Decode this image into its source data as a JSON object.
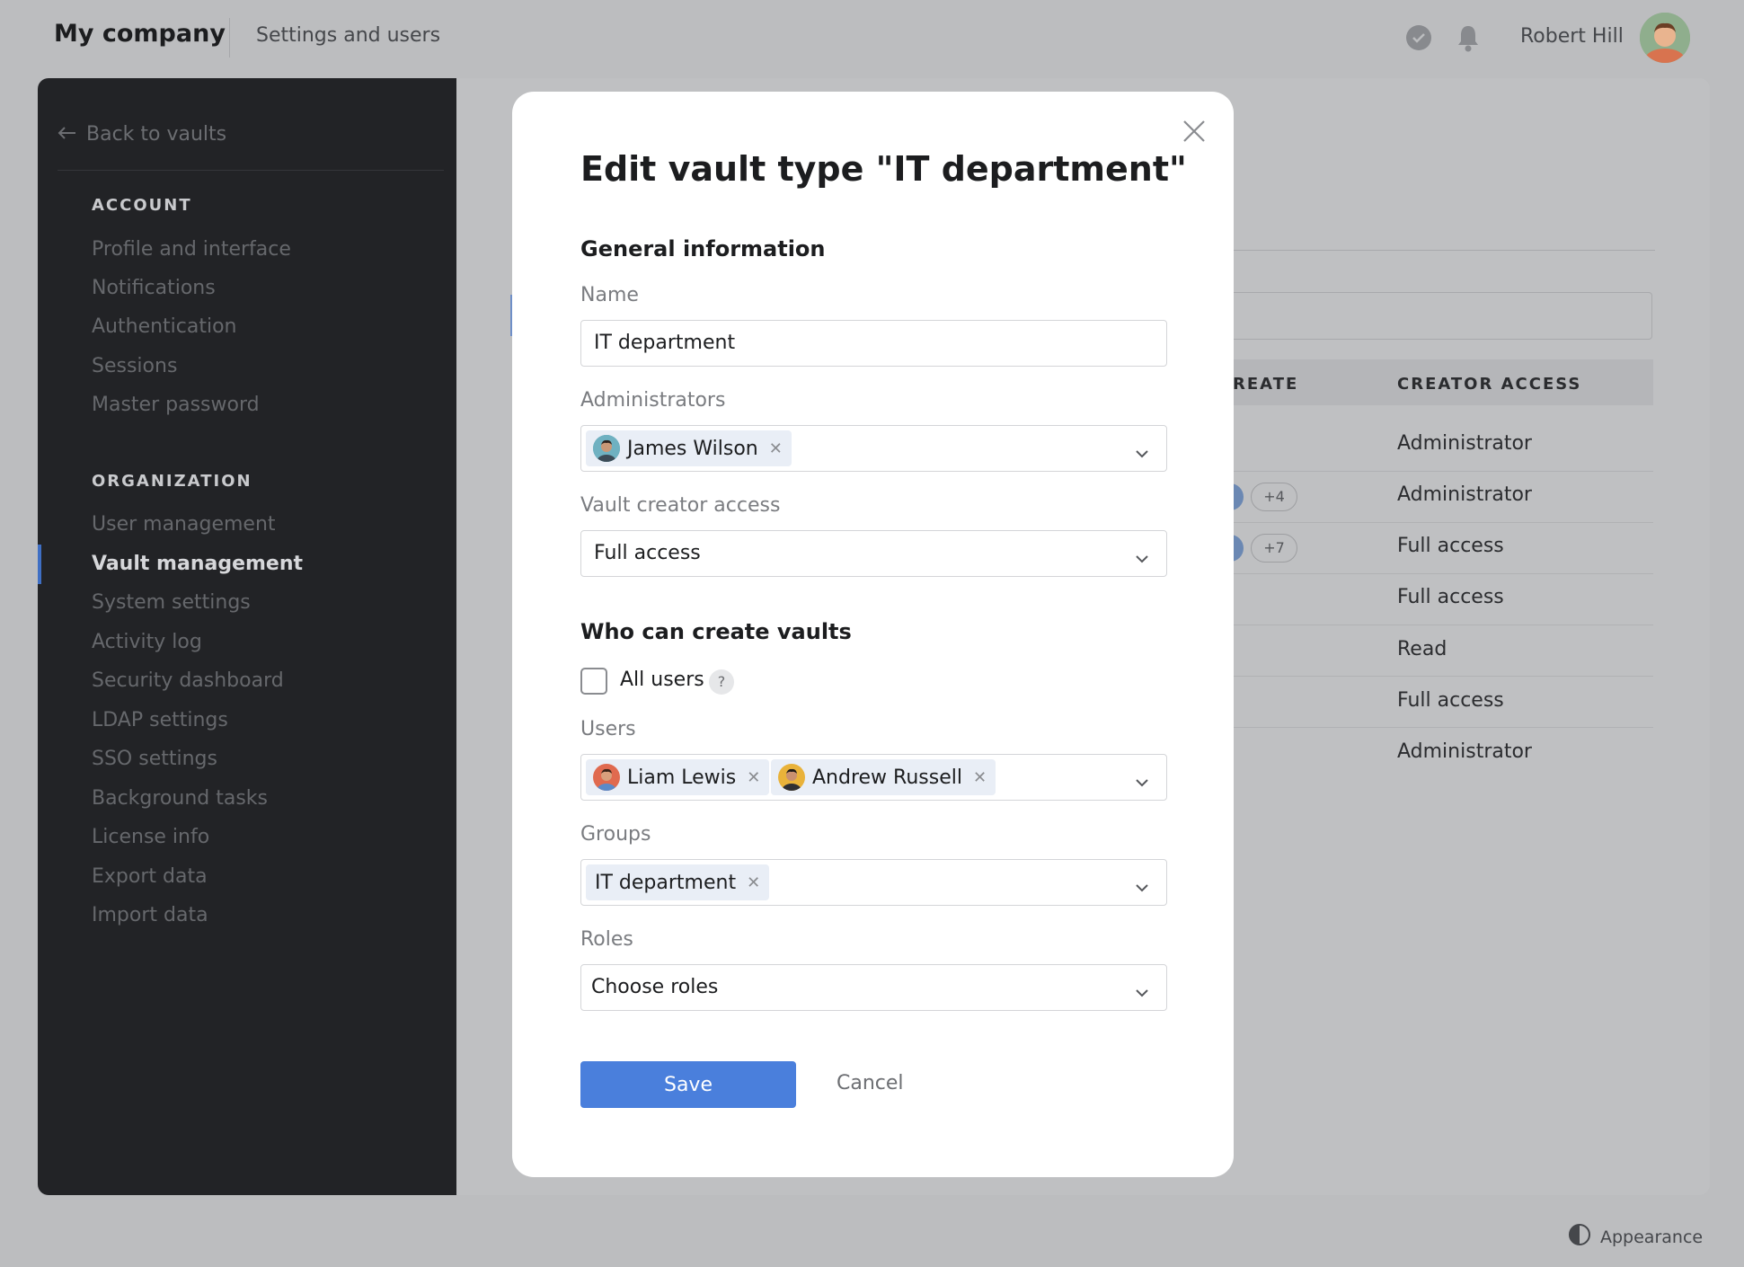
{
  "topbar": {
    "brand": "My company",
    "breadcrumb": "Settings and users",
    "user_name": "Robert Hill"
  },
  "sidebar": {
    "back_label": "Back to vaults",
    "account_heading": "ACCOUNT",
    "account_items": [
      "Profile and interface",
      "Notifications",
      "Authentication",
      "Sessions",
      "Master password"
    ],
    "organization_heading": "ORGANIZATION",
    "organization_items": [
      "User management",
      "Vault management",
      "System settings",
      "Activity log",
      "Security dashboard",
      "LDAP settings",
      "SSO settings",
      "Background tasks",
      "License info",
      "Export data",
      "Import data"
    ],
    "active_item": "Vault management"
  },
  "background_table": {
    "col_create_partial": "REATE",
    "col_creator_access": "CREATOR ACCESS",
    "rows": [
      {
        "creator_access": "Administrator",
        "more": ""
      },
      {
        "creator_access": "Administrator",
        "more": "+4"
      },
      {
        "creator_access": "Full access",
        "more": "+7"
      },
      {
        "creator_access": "Full access",
        "more": ""
      },
      {
        "creator_access": "Read",
        "more": ""
      },
      {
        "creator_access": "Full access",
        "more": ""
      },
      {
        "creator_access": "Administrator",
        "more": ""
      }
    ]
  },
  "appearance_label": "Appearance",
  "modal": {
    "title": "Edit vault type \"IT department\"",
    "general_heading": "General information",
    "name_label": "Name",
    "name_value": "IT department",
    "admins_label": "Administrators",
    "admins": [
      "James Wilson"
    ],
    "creator_access_label": "Vault creator access",
    "creator_access_value": "Full access",
    "who_heading": "Who can create vaults",
    "all_users_label": "All users",
    "help_glyph": "?",
    "users_label": "Users",
    "users": [
      "Liam Lewis",
      "Andrew Russell"
    ],
    "groups_label": "Groups",
    "groups": [
      "IT department"
    ],
    "roles_label": "Roles",
    "roles_placeholder": "Choose roles",
    "save_label": "Save",
    "cancel_label": "Cancel"
  },
  "colors": {
    "primary": "#4a7fdc",
    "sidebar_bg": "#222326",
    "chip_bg": "#e9eef6"
  },
  "icons": [
    "check-circle-icon",
    "bell-icon",
    "back-arrow-icon",
    "close-icon",
    "chevron-down-icon",
    "remove-chip-icon",
    "help-icon",
    "contrast-icon"
  ]
}
